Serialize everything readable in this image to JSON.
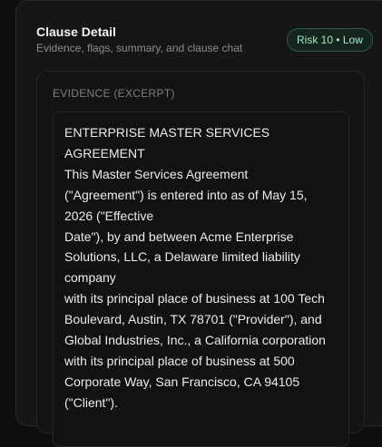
{
  "panel": {
    "title": "Clause Detail",
    "subtitle": "Evidence, flags, summary, and clause chat",
    "risk_badge": "Risk 10 • Low"
  },
  "evidence": {
    "header": "EVIDENCE (EXCERPT)",
    "lines": [
      "ENTERPRISE MASTER SERVICES",
      "AGREEMENT",
      "This Master Services Agreement",
      "(\"Agreement\") is entered into as of May 15,",
      "2026 (\"Effective",
      "Date\"), by and between Acme Enterprise",
      "Solutions, LLC, a Delaware limited liability",
      "company",
      "with its principal place of business at 100 Tech",
      "Boulevard, Austin, TX 78701 (\"Provider\"), and",
      "Global Industries, Inc., a California corporation",
      "with its principal place of business at 500",
      "Corporate Way, San Francisco, CA 94105",
      "(\"Client\")."
    ]
  },
  "colors": {
    "background": "#0f0f0f",
    "panel": "#161616",
    "badge_text": "#a3e8c4",
    "badge_border": "#2f5b45"
  }
}
